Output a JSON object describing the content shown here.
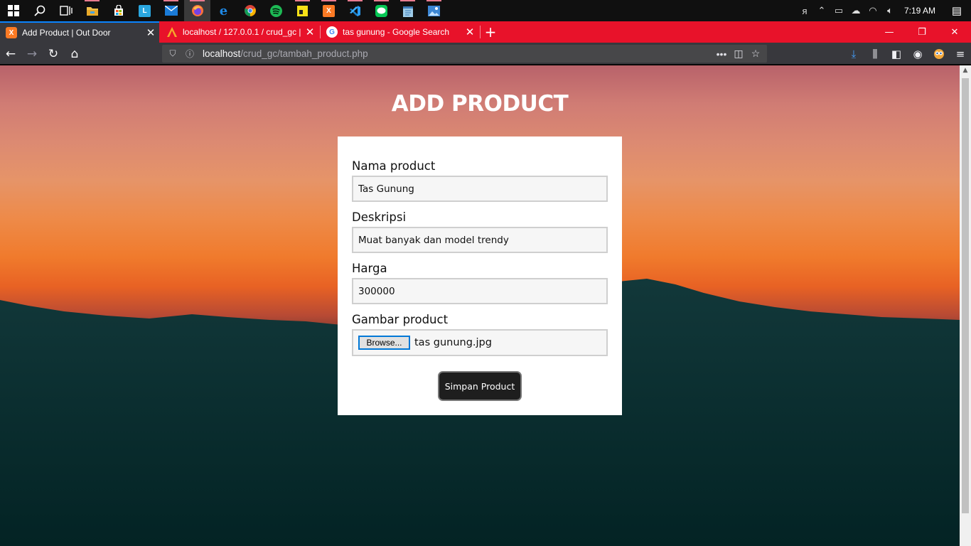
{
  "taskbar": {
    "apps": [
      {
        "name": "start",
        "icon": "windows-icon"
      },
      {
        "name": "search",
        "icon": "search-icon"
      },
      {
        "name": "task-view",
        "icon": "task-view-icon"
      },
      {
        "name": "file-explorer",
        "icon": "folder-icon",
        "color": "#f2c14e"
      },
      {
        "name": "store",
        "icon": "store-icon",
        "color": "#ffffff"
      },
      {
        "name": "app-l",
        "icon": "l-app-icon",
        "color": "#2aa7e0",
        "glyph": "L"
      },
      {
        "name": "mail",
        "icon": "mail-icon",
        "color": "#1a7bd8"
      },
      {
        "name": "firefox",
        "icon": "firefox-icon",
        "color": "#ff7139"
      },
      {
        "name": "edge",
        "icon": "edge-icon",
        "color": "#1e88e5",
        "glyph": "e"
      },
      {
        "name": "chrome",
        "icon": "chrome-icon",
        "color": "#4caf50"
      },
      {
        "name": "spotify",
        "icon": "spotify-icon",
        "color": "#1db954"
      },
      {
        "name": "sticky-notes",
        "icon": "sticky-notes-icon",
        "color": "#f7e017"
      },
      {
        "name": "xampp",
        "icon": "xampp-icon",
        "color": "#fb7a24",
        "glyph": "X"
      },
      {
        "name": "vscode",
        "icon": "vscode-icon",
        "color": "#2a9df4"
      },
      {
        "name": "line",
        "icon": "line-icon",
        "color": "#06c755"
      },
      {
        "name": "notepad",
        "icon": "notepad-icon",
        "color": "#9ecbe8"
      },
      {
        "name": "photos",
        "icon": "photos-icon",
        "color": "#3b86d4"
      }
    ],
    "clock": "7:19 AM"
  },
  "tabs": [
    {
      "title": "Add Product | Out Door",
      "fav_color": "#fb7a24",
      "fav_glyph": "X",
      "active": true
    },
    {
      "title": "localhost / 127.0.0.1 / crud_gc |",
      "fav_color": "#e8122a",
      "fav_glyph": "",
      "active": false
    },
    {
      "title": "tas gunung - Google Search",
      "fav_color": "#ffffff",
      "fav_glyph": "G",
      "active": false
    }
  ],
  "urlbar": {
    "host": "localhost",
    "path": "/crud_gc/tambah_product.php"
  },
  "page": {
    "title": "ADD PRODUCT",
    "fields": {
      "nama_label": "Nama product",
      "nama_value": "Tas Gunung",
      "deskripsi_label": "Deskripsi",
      "deskripsi_value": "Muat banyak dan model trendy",
      "harga_label": "Harga",
      "harga_value": "300000",
      "gambar_label": "Gambar product",
      "browse_label": "Browse...",
      "file_name": "tas gunung.jpg"
    },
    "submit_label": "Simpan Product"
  }
}
